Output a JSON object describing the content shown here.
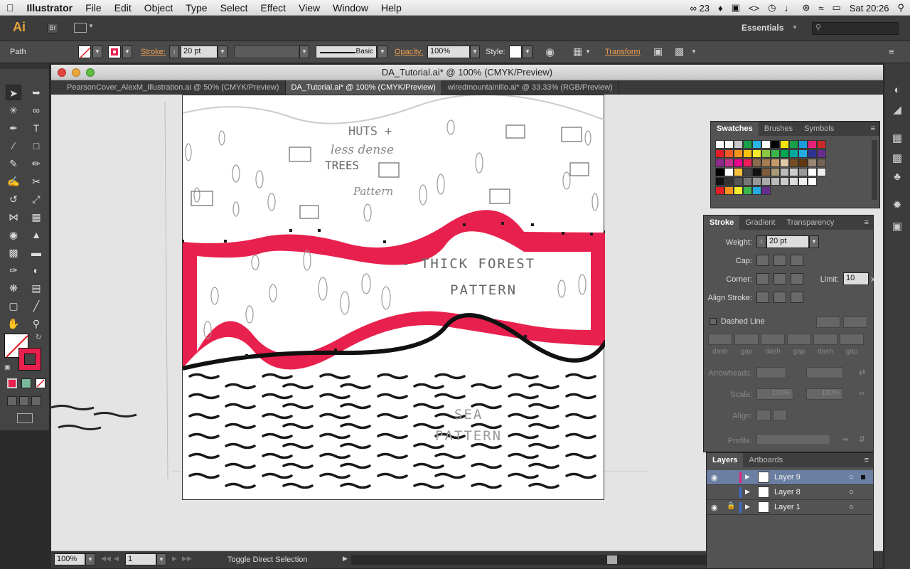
{
  "menubar": {
    "app": "Illustrator",
    "items": [
      "File",
      "Edit",
      "Object",
      "Type",
      "Select",
      "Effect",
      "View",
      "Window",
      "Help"
    ],
    "status_a": "23",
    "clock": "Sat 20:26"
  },
  "appbar": {
    "logo": "Ai",
    "bridge": "Br",
    "workspace": "Essentials"
  },
  "control": {
    "selection": "Path",
    "stroke_label": "Stroke:",
    "stroke_weight": "20 pt",
    "brush": "Basic",
    "opacity_label": "Opacity:",
    "opacity": "100%",
    "style_label": "Style:",
    "transform": "Transform"
  },
  "document": {
    "title": "DA_Tutorial.ai* @ 100% (CMYK/Preview)",
    "tabs": [
      "PearsonCover_AlexM_Illustration.ai @ 50% (CMYK/Preview)",
      "DA_Tutorial.ai* @ 100% (CMYK/Preview)",
      "wiredmountainillo.ai* @ 33.33% (RGB/Preview)"
    ],
    "sketch": {
      "huts": "HUTS +",
      "less_dense": "less dense",
      "trees": "TREES",
      "pattern1": "Pattern",
      "thick_forest": "- THICK FOREST",
      "pattern2": "PATTERN",
      "sea": "SEA",
      "pattern3": "PATTERN"
    }
  },
  "statusbar": {
    "zoom": "100%",
    "artboard": "1",
    "hint": "Toggle Direct Selection"
  },
  "swatches_panel": {
    "tabs": [
      "Swatches",
      "Brushes",
      "Symbols"
    ],
    "colors": [
      [
        "#ffffff",
        "#ffffff",
        "#c8c8c8",
        "#1aa04b",
        "#2ab3e6",
        "#ffffff",
        "#000000",
        "#f5e30c",
        "#14a14a",
        "#1a9ed9",
        "#e8207a",
        "#cc2a2a"
      ],
      [
        "#e31e24",
        "#f05a24",
        "#f7941d",
        "#fbc20f",
        "#f4ec2d",
        "#8dc63f",
        "#39b54a",
        "#00a651",
        "#00a99d",
        "#27aae1",
        "#2e3192",
        "#662d91"
      ],
      [
        "#8e2a8b",
        "#c62f8e",
        "#ec008c",
        "#ed1c5a",
        "#8b6a4e",
        "#a67c52",
        "#c69c6d",
        "#e0c9a6",
        "#754c24",
        "#603913",
        "#998675",
        "#736357"
      ],
      [
        "#000000",
        "#ffffff",
        "#f7c03c",
        "#444444",
        "#111111",
        "#7d5c3c",
        "#aa9977",
        "#bbbbbb",
        "#cccccc",
        "#999999",
        "#ffffff",
        "#eeeeee"
      ],
      [
        "#111111",
        "#333333",
        "#555555",
        "#777777",
        "#999999",
        "#aaaaaa",
        "#bbbbbb",
        "#cccccc",
        "#dddddd",
        "#eeeeee",
        "#ffffff",
        ""
      ],
      [
        "#e31e24",
        "#f7941d",
        "#f4ec2d",
        "#39b54a",
        "#27aae1",
        "#662d91",
        "",
        "",
        "",
        "",
        "",
        ""
      ]
    ]
  },
  "stroke_panel": {
    "tabs": [
      "Stroke",
      "Gradient",
      "Transparency"
    ],
    "weight_label": "Weight:",
    "weight": "20 pt",
    "cap_label": "Cap:",
    "corner_label": "Corner:",
    "limit_label": "Limit:",
    "limit": "10",
    "limit_unit": "x",
    "align_label": "Align Stroke:",
    "dashed_label": "Dashed Line",
    "dash_labels": [
      "dash",
      "gap",
      "dash",
      "gap",
      "dash",
      "gap"
    ],
    "arrowheads_label": "Arrowheads:",
    "scale_label": "Scale:",
    "scale_a": "100%",
    "scale_b": "100%",
    "align2_label": "Align:",
    "profile_label": "Profile:"
  },
  "layers_panel": {
    "tabs": [
      "Layers",
      "Artboards"
    ],
    "layers": [
      {
        "name": "Layer 9",
        "color": "#e8207a"
      },
      {
        "name": "Layer 8",
        "color": "#3b6cd4"
      },
      {
        "name": "Layer 1",
        "color": "#3b6cd4"
      }
    ]
  },
  "colors": {
    "accent": "#e8204d",
    "stroke_black": "#111111"
  }
}
